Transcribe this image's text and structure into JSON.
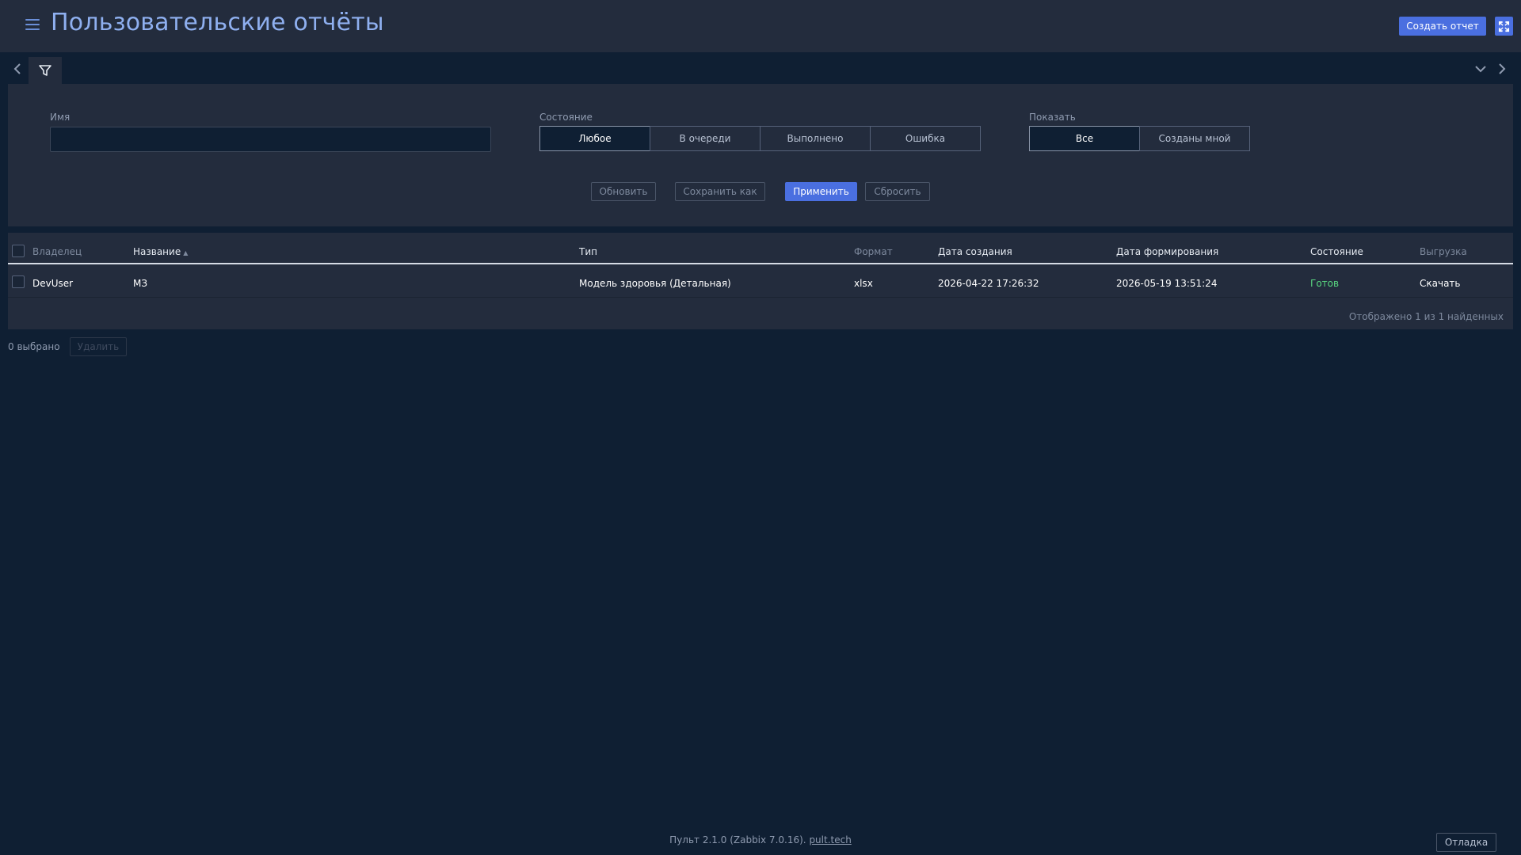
{
  "header": {
    "title": "Пользовательские отчёты",
    "create_button": "Создать отчет"
  },
  "filter": {
    "name_label": "Имя",
    "name_value": "",
    "state_label": "Состояние",
    "state_options": [
      "Любое",
      "В очереди",
      "Выполнено",
      "Ошибка"
    ],
    "state_selected": "Любое",
    "show_label": "Показать",
    "show_options": [
      "Все",
      "Созданы мной"
    ],
    "show_selected": "Все",
    "buttons": {
      "update": "Обновить",
      "save_as": "Сохранить как",
      "apply": "Применить",
      "reset": "Сбросить"
    }
  },
  "table": {
    "columns": [
      "Владелец",
      "Название",
      "Тип",
      "Формат",
      "Дата создания",
      "Дата формирования",
      "Состояние",
      "Выгрузка"
    ],
    "sort_column": "Название",
    "rows": [
      {
        "owner": "DevUser",
        "name": "МЗ",
        "type": "Модель здоровья (Детальная)",
        "format": "xlsx",
        "created": "2026-04-22 17:26:32",
        "generated": "2026-05-19 13:51:24",
        "status": "Готов",
        "download": "Скачать"
      }
    ],
    "paging_text": "Отображено 1 из 1 найденных"
  },
  "selection": {
    "count_text": "0 выбрано",
    "delete_button": "Удалить"
  },
  "footer": {
    "version_text": "Пульт 2.1.0 (Zabbix 7.0.16).",
    "link_text": "pult.tech",
    "debug_button": "Отладка"
  },
  "colors": {
    "accent": "#4a6fe0",
    "title": "#8fb0f0",
    "status_ok": "#59d680",
    "background": "#0f1f33",
    "panel": "#232c3d"
  },
  "icons": [
    "menu-icon",
    "fullscreen-icon",
    "chevron-left-icon",
    "filter-icon",
    "chevron-down-icon",
    "chevron-right-icon",
    "sort-asc-icon"
  ]
}
